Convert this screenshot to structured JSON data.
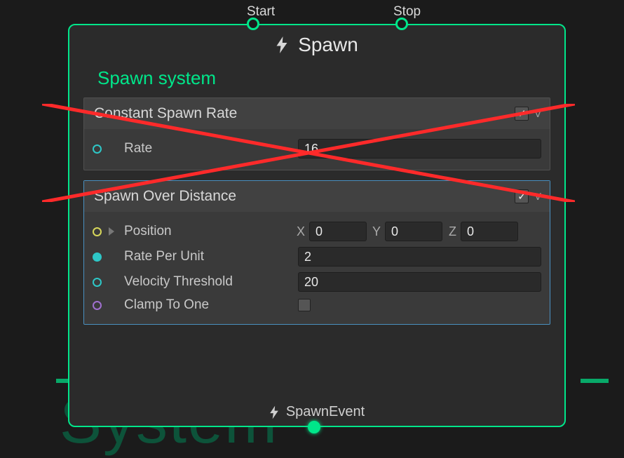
{
  "background": {
    "watermark": "System"
  },
  "node": {
    "title": "Spawn",
    "system_label": "Spawn system",
    "ports": {
      "start_label": "Start",
      "stop_label": "Stop"
    },
    "footer": {
      "label": "SpawnEvent"
    }
  },
  "blocks": {
    "constant_spawn_rate": {
      "title": "Constant Spawn Rate",
      "enabled_checked": "✓",
      "rate_label": "Rate",
      "rate_value": "16"
    },
    "spawn_over_distance": {
      "title": "Spawn Over Distance",
      "enabled_checked": "✓",
      "position": {
        "label": "Position",
        "x_label": "X",
        "x": "0",
        "y_label": "Y",
        "y": "0",
        "z_label": "Z",
        "z": "0"
      },
      "rate_per_unit": {
        "label": "Rate Per Unit",
        "value": "2"
      },
      "velocity_threshold": {
        "label": "Velocity Threshold",
        "value": "20"
      },
      "clamp_to_one": {
        "label": "Clamp To One",
        "checked": ""
      }
    }
  },
  "annotation": {
    "crossout": true
  }
}
